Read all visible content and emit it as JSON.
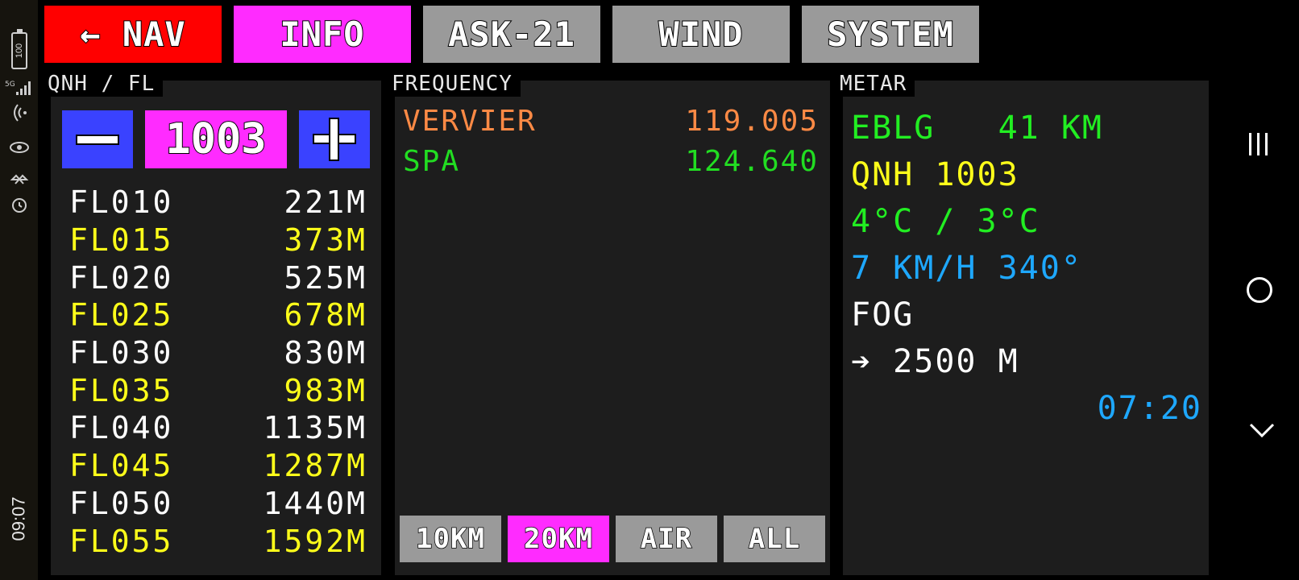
{
  "status_bar": {
    "battery_level": "100",
    "network_label": "5G",
    "time": "09:07",
    "icons": [
      "battery-icon",
      "signal-icon",
      "wifi-icon",
      "eye-icon",
      "bluetooth-icon",
      "alarm-icon"
    ]
  },
  "tabs": [
    {
      "label": "← NAV",
      "color": "#ff0000"
    },
    {
      "label": "INFO",
      "color": "#ff2bff",
      "active": true
    },
    {
      "label": "ASK-21",
      "color": "#9a9a9a"
    },
    {
      "label": "WIND",
      "color": "#9a9a9a"
    },
    {
      "label": "SYSTEM",
      "color": "#9a9a9a"
    }
  ],
  "qnh_panel": {
    "title": "QNH / FL",
    "qnh_value": "1003",
    "flight_levels": [
      {
        "fl": "FL010",
        "alt": "221M"
      },
      {
        "fl": "FL015",
        "alt": "373M"
      },
      {
        "fl": "FL020",
        "alt": "525M"
      },
      {
        "fl": "FL025",
        "alt": "678M"
      },
      {
        "fl": "FL030",
        "alt": "830M"
      },
      {
        "fl": "FL035",
        "alt": "983M"
      },
      {
        "fl": "FL040",
        "alt": "1135M"
      },
      {
        "fl": "FL045",
        "alt": "1287M"
      },
      {
        "fl": "FL050",
        "alt": "1440M"
      },
      {
        "fl": "FL055",
        "alt": "1592M"
      }
    ]
  },
  "frequency_panel": {
    "title": "FREQUENCY",
    "rows": [
      {
        "name": "VERVIER",
        "freq": "119.005",
        "color": "#ff8a45"
      },
      {
        "name": "SPA",
        "freq": "124.640",
        "color": "#22dd22"
      }
    ],
    "range_buttons": [
      {
        "label": "10KM"
      },
      {
        "label": "20KM",
        "active": true
      },
      {
        "label": "AIR"
      },
      {
        "label": "ALL"
      }
    ]
  },
  "metar_panel": {
    "title": "METAR",
    "station": "EBLG   41 KM",
    "qnh": "QNH 1003",
    "temperature": "4°C / 3°C",
    "wind": "7 KM/H 340°",
    "weather": "FOG",
    "visibility": "➔ 2500 M",
    "time": "07:20"
  },
  "colors": {
    "accent_magenta": "#ff2bff",
    "nav_red": "#ff0000",
    "button_blue": "#3a42ff",
    "gray_tab": "#9a9a9a",
    "yellow": "#ffff1a",
    "green": "#22ee22",
    "cyan": "#1ea8ff",
    "orange": "#ff8a45"
  }
}
